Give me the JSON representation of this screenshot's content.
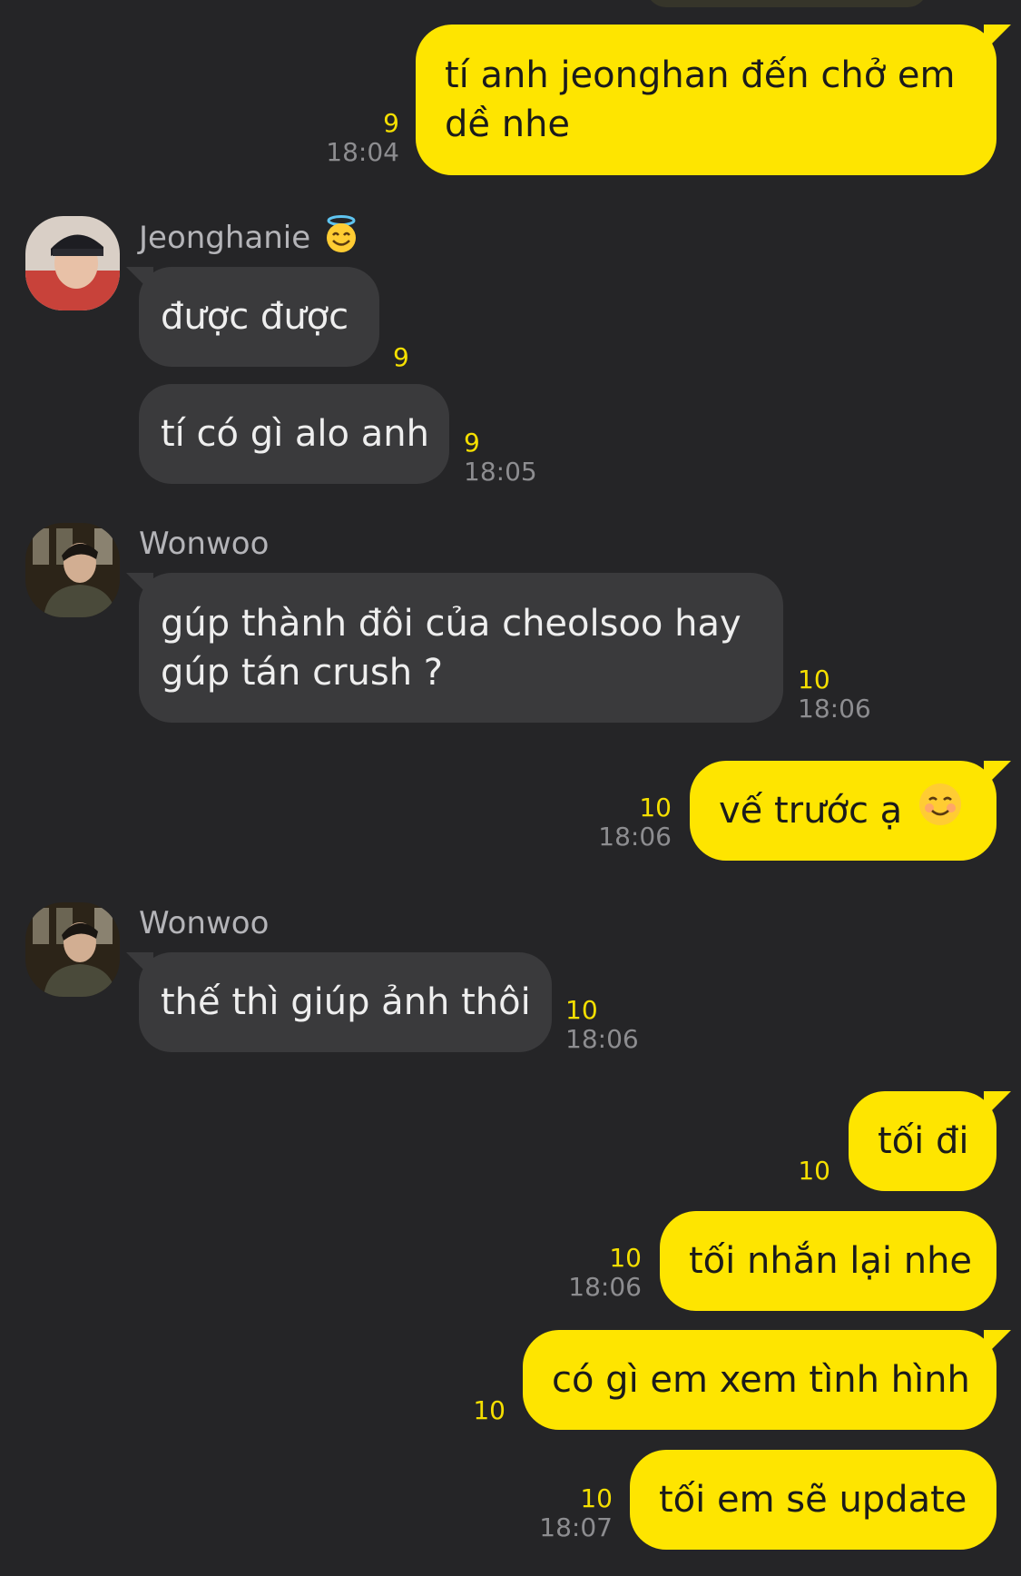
{
  "messages": {
    "m1": {
      "text": "tí anh jeonghan đến chở em dề nhe",
      "count": "9",
      "time": "18:04"
    },
    "jeonghan": {
      "sender": "Jeonghanie",
      "m2": {
        "text": "được được",
        "count": "9"
      },
      "m3": {
        "text": "tí có gì alo anh",
        "count": "9",
        "time": "18:05"
      }
    },
    "wonwoo1": {
      "sender": "Wonwoo",
      "m4": {
        "text": "gúp thành đôi của cheolsoo hay gúp tán crush ?",
        "count": "10",
        "time": "18:06"
      }
    },
    "m5": {
      "text": "vế trước ạ",
      "count": "10",
      "time": "18:06"
    },
    "wonwoo2": {
      "sender": "Wonwoo",
      "m6": {
        "text": "thế thì giúp ảnh thôi",
        "count": "10",
        "time": "18:06"
      }
    },
    "m7": {
      "text": "tối đi",
      "count": "10"
    },
    "m8": {
      "text": "tối nhắn lại nhe",
      "count": "10",
      "time": "18:06"
    },
    "m9": {
      "text": "có gì em xem tình hình",
      "count": "10"
    },
    "m10": {
      "text": "tối em sẽ update",
      "count": "10",
      "time": "18:07"
    }
  },
  "icons": {
    "halo": "smiling-face-with-halo-icon",
    "blush": "smiling-face-icon"
  },
  "colors": {
    "background": "#252527",
    "outgoing_bubble": "#fee500",
    "incoming_bubble": "#3a3a3c",
    "unread_count": "#f5df00",
    "timestamp": "#8d8d90"
  }
}
